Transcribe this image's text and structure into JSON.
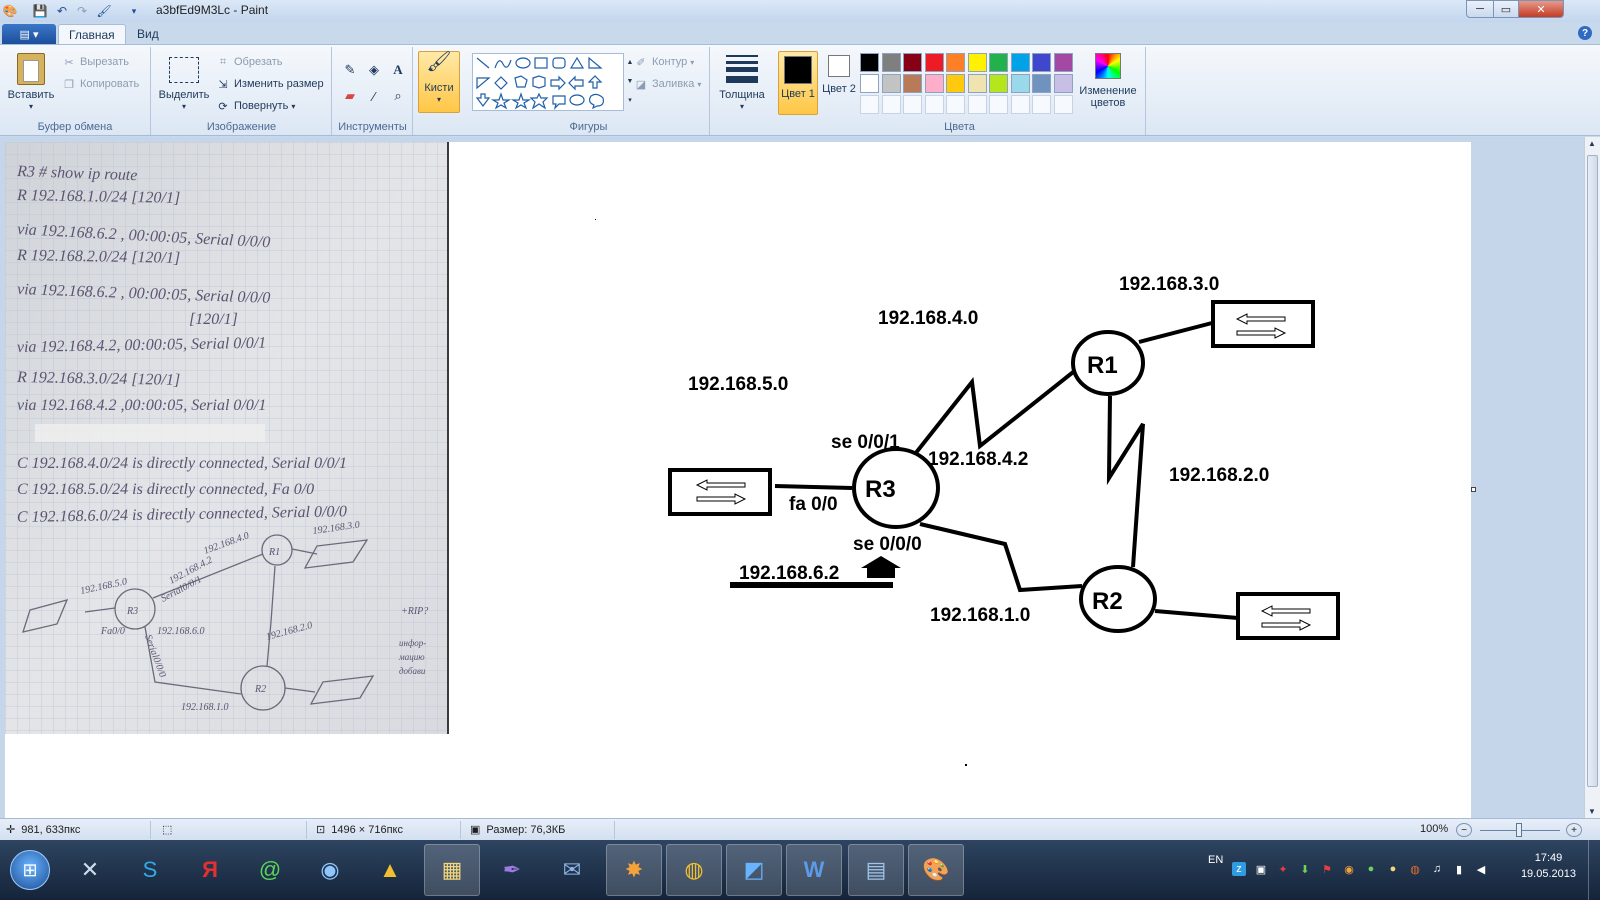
{
  "window": {
    "title": "a3bfEd9M3Lc - Paint",
    "minimize": "─",
    "maximize": "▭",
    "close": "✕"
  },
  "tabs": {
    "menu_label": "▤ ▾",
    "home": "Главная",
    "view": "Вид"
  },
  "ribbon": {
    "clipboard": {
      "label": "Буфер обмена",
      "paste": "Вставить",
      "cut": "Вырезать",
      "copy": "Копировать"
    },
    "image": {
      "label": "Изображение",
      "select": "Выделить",
      "crop": "Обрезать",
      "resize": "Изменить размер",
      "rotate": "Повернуть"
    },
    "tools": {
      "label": "Инструменты"
    },
    "brushes": {
      "label": "Кисти"
    },
    "shapes": {
      "label": "Фигуры",
      "outline": "Контур",
      "fill": "Заливка"
    },
    "size": {
      "label": "Толщина"
    },
    "colors": {
      "label": "Цвета",
      "color1": "Цвет 1",
      "color2": "Цвет 2",
      "edit": "Изменение цветов",
      "palette_row1": [
        "#000000",
        "#7f7f7f",
        "#880015",
        "#ed1c24",
        "#ff7f27",
        "#fff200",
        "#22b14c",
        "#00a2e8",
        "#3f48cc",
        "#a349a4"
      ],
      "palette_row2": [
        "#ffffff",
        "#c3c3c3",
        "#b97a57",
        "#ffaec9",
        "#ffc90e",
        "#efe4b0",
        "#b5e61d",
        "#99d9ea",
        "#7092be",
        "#c8bfe7"
      ]
    }
  },
  "notebook": {
    "lines": [
      "R3 # show ip route",
      "R 192.168.1.0/24 [120/1]",
      "via 192.168.6.2 , 00:00:05, Serial 0/0/0",
      "R 192.168.2.0/24 [120/1]",
      "via 192.168.6.2 , 00:00:05, Serial 0/0/0",
      "[120/1]",
      "via 192.168.4.2, 00:00:05, Serial 0/0/1",
      "R 192.168.3.0/24 [120/1]",
      "via 192.168.4.2 ,00:00:05, Serial 0/0/1",
      "C 192.168.4.0/24 is directly connected, Serial 0/0/1",
      "C 192.168.5.0/24 is directly connected, Fa 0/0",
      "C 192.168.6.0/24 is directly connected, Serial 0/0/0"
    ],
    "sketch": {
      "r1": "R1",
      "r2": "R2",
      "r3": "R3",
      "net5": "192.168.5.0",
      "net4": "192.168.4.0",
      "net3": "192.168.3.0",
      "net2": "192.168.2.0",
      "net1": "192.168.1.0",
      "net6": "192.168.6.0",
      "fa": "Fa0/0",
      "s1": "Serial0/0/1",
      "s0": "Serial0/0/0",
      "ip42": "192.168.4.2",
      "note1": "+RIP?",
      "note2": "инфор-",
      "note3": "мацию",
      "note4": "добави"
    }
  },
  "diagram": {
    "r1": "R1",
    "r2": "R2",
    "r3": "R3",
    "net3": "192.168.3.0",
    "net4": "192.168.4.0",
    "net5": "192.168.5.0",
    "net2": "192.168.2.0",
    "net1": "192.168.1.0",
    "se001": "se 0/0/1",
    "se000": "se 0/0/0",
    "fa00": "fa 0/0",
    "ip42": "192.168.4.2",
    "ip62": "192.168.6.2"
  },
  "statusbar": {
    "cursor": "981, 633пкс",
    "canvas_size": "1496 × 716пкс",
    "file_size": "Размер: 76,3КБ",
    "zoom": "100%"
  },
  "taskbar": {
    "lang": "EN",
    "time": "17:49",
    "date": "19.05.2013"
  }
}
